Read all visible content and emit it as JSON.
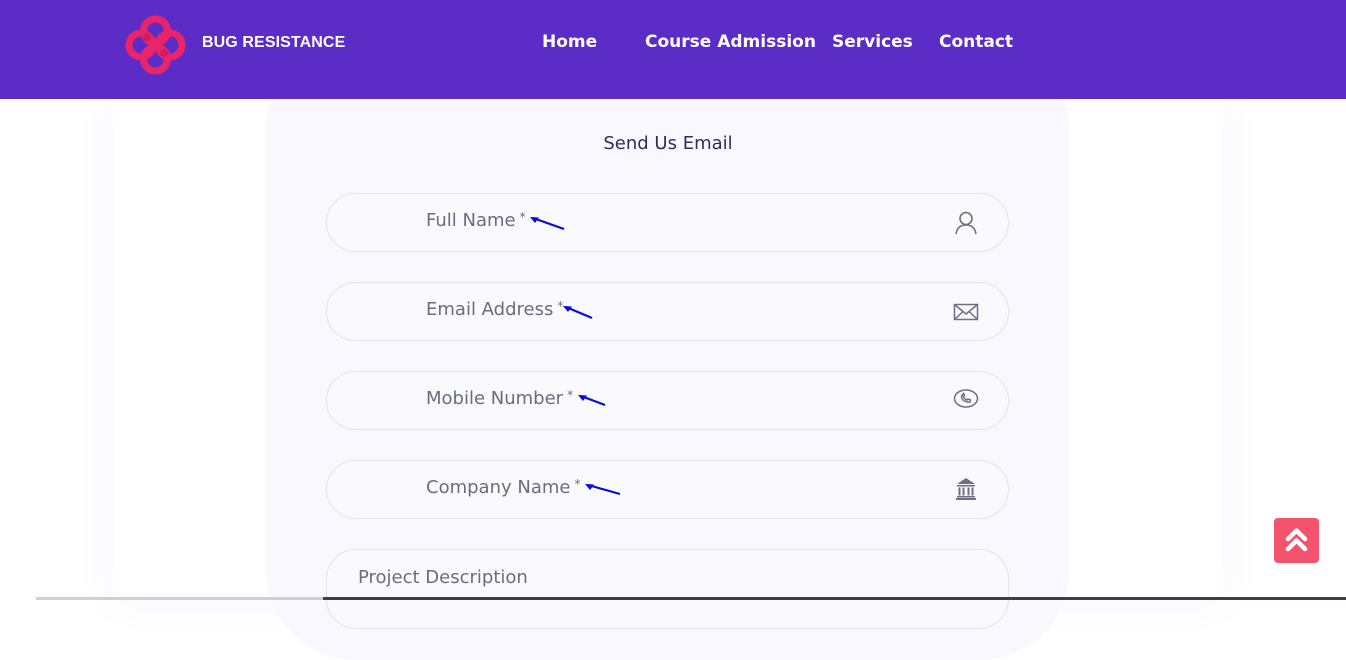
{
  "header": {
    "brand": "BUG RESISTANCE",
    "nav": [
      {
        "label": "Home"
      },
      {
        "label": "Course Admission"
      },
      {
        "label": "Services"
      },
      {
        "label": "Contact"
      }
    ],
    "colors": {
      "background": "#5b2cc6",
      "logo": "#e8246b"
    }
  },
  "form": {
    "title": "Send Us Email",
    "fields": [
      {
        "label": "Full Name",
        "required_mark": "*",
        "icon": "user-icon"
      },
      {
        "label": "Email Address",
        "required_mark": "*",
        "icon": "envelope-icon"
      },
      {
        "label": "Mobile Number",
        "required_mark": "*",
        "icon": "phone-icon"
      },
      {
        "label": "Company Name",
        "required_mark": "*",
        "icon": "bank-icon"
      }
    ],
    "description_label": "Project Description"
  },
  "annotation_arrow_color": "#0a0ad8",
  "scroll_top": {
    "icon": "double-chevron-up-icon",
    "color": "#f4536e"
  }
}
